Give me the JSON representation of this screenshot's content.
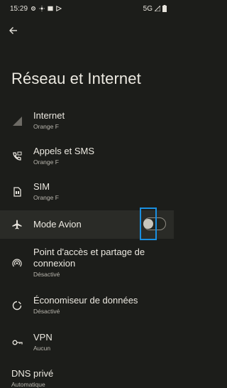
{
  "status_bar": {
    "time": "15:29",
    "network": "5G",
    "icons": [
      "gear-icon",
      "brightness-icon",
      "cast-icon",
      "play-icon",
      "signal-icon",
      "battery-icon"
    ]
  },
  "header": {
    "back_icon": "arrow-left-icon",
    "title": "Réseau et Internet"
  },
  "items": [
    {
      "icon": "signal-icon",
      "title": "Internet",
      "subtitle": "Orange F"
    },
    {
      "icon": "phone-sms-icon",
      "title": "Appels et SMS",
      "subtitle": "Orange F"
    },
    {
      "icon": "sim-icon",
      "title": "SIM",
      "subtitle": "Orange F"
    },
    {
      "icon": "airplane-icon",
      "title": "Mode Avion",
      "subtitle": "",
      "toggle": false
    },
    {
      "icon": "hotspot-icon",
      "title": "Point d'accès et partage de connexion",
      "subtitle": "Désactivé"
    },
    {
      "icon": "data-saver-icon",
      "title": "Économiseur de données",
      "subtitle": "Désactivé"
    },
    {
      "icon": "vpn-key-icon",
      "title": "VPN",
      "subtitle": "Aucun"
    }
  ],
  "dns": {
    "title": "DNS privé",
    "subtitle": "Automatique"
  },
  "colors": {
    "background": "#1c1d1a",
    "highlight": "#2a2b27",
    "focus": "#1a8fe0"
  }
}
